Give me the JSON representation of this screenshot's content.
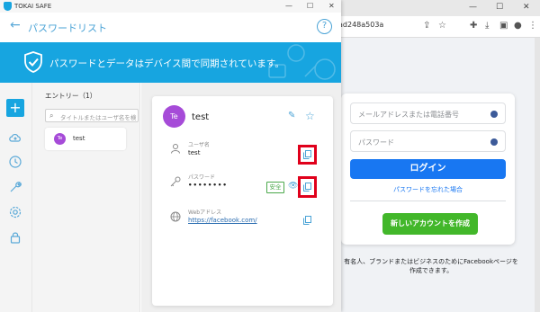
{
  "browser": {
    "url_fragment": "ad248a503a",
    "facebook": {
      "email_placeholder": "メールアドレスまたは電話番号",
      "password_placeholder": "パスワード",
      "login_button": "ログイン",
      "forgot_password": "パスワードを忘れた場合",
      "create_account_button": "新しいアカウントを作成",
      "page_note_line1": "有名人、ブランドまたはビジネスのためにFacebookページを",
      "page_note_line2": "作成できます。"
    }
  },
  "app": {
    "window_title": "TOKAI SAFE",
    "header_title": "パスワードリスト",
    "help_label": "?",
    "banner_text": "パスワードとデータはデバイス間で同期されています。",
    "colors": {
      "accent": "#17a5e0",
      "avatar": "#a64bd8",
      "highlight": "#e0001b",
      "safe": "#4aa84a"
    },
    "sidebar": {
      "add_label": "+",
      "icons": [
        "cloud-sync-icon",
        "history-icon",
        "tools-icon",
        "settings-icon",
        "lock-icon"
      ]
    },
    "entries": {
      "header": "エントリー（1）",
      "search_placeholder": "タイトルまたはユーザ名を検",
      "items": [
        {
          "initials": "Te",
          "label": "test"
        }
      ]
    },
    "detail": {
      "initials": "Te",
      "title": "test",
      "username_label": "ユーザ名",
      "username_value": "test",
      "password_label": "パスワード",
      "password_value": "••••••••",
      "safe_badge": "安全",
      "web_label": "Webアドレス",
      "web_value": "https://facebook.com/"
    }
  }
}
